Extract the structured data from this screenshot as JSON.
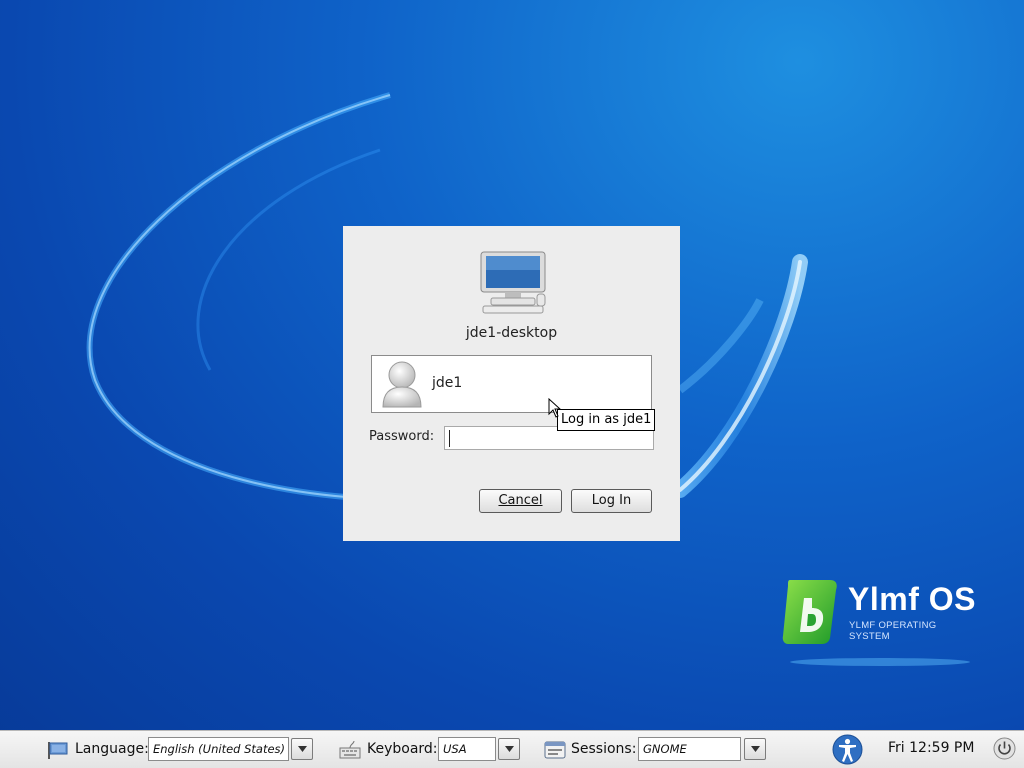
{
  "dialog": {
    "host_name": "jde1-desktop",
    "user_name": "jde1",
    "password_label": "Password:",
    "password_value": "",
    "cancel_label": "Cancel",
    "login_label": "Log In",
    "tooltip": "Log in as jde1"
  },
  "brand": {
    "name": "Ylmf OS",
    "tagline": "YLMF OPERATING SYSTEM"
  },
  "panel": {
    "language_label": "Language:",
    "language_value": "English (United States)",
    "keyboard_label": "Keyboard:",
    "keyboard_value": "USA",
    "sessions_label": "Sessions:",
    "sessions_value": "GNOME",
    "clock": "Fri 12:59 PM"
  },
  "colors": {
    "desktop_blue": "#0a48b0",
    "dialog_bg": "#ededed",
    "brand_green": "#3bb53a"
  },
  "icons": [
    "computer-icon",
    "user-avatar-icon",
    "mouse-cursor-icon",
    "language-flag-icon",
    "keyboard-icon",
    "sessions-icon",
    "accessibility-icon",
    "power-icon",
    "dropdown-arrow-icon"
  ]
}
